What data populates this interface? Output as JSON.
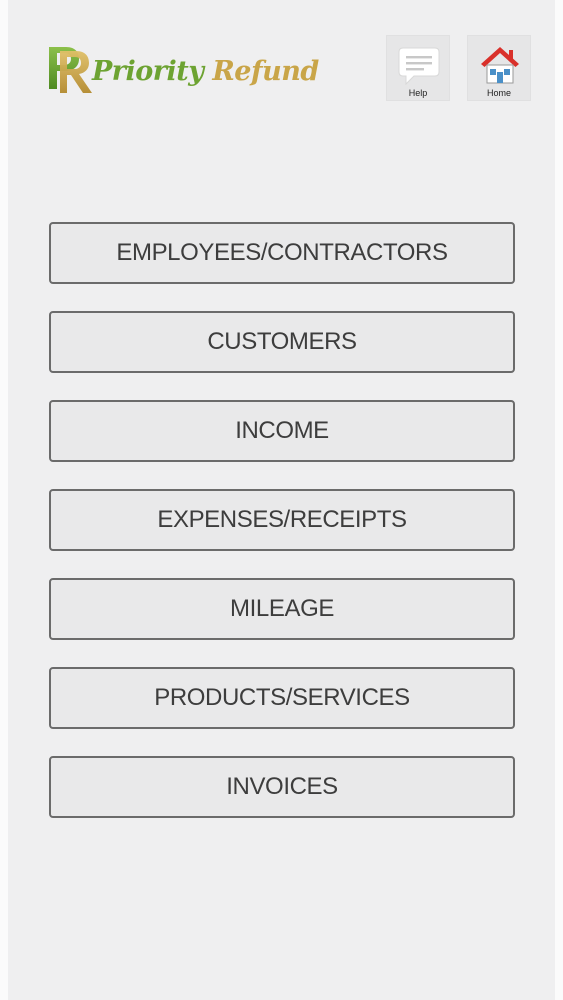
{
  "brand": {
    "logo_text_first": "Priority",
    "logo_text_second": "Refund",
    "color_green": "#6da332",
    "color_gold": "#c9a548"
  },
  "header": {
    "help": {
      "label": "Help",
      "icon": "speech-bubble-icon"
    },
    "home": {
      "label": "Home",
      "icon": "house-icon"
    }
  },
  "menu": {
    "items": [
      {
        "label": "EMPLOYEES/CONTRACTORS"
      },
      {
        "label": "CUSTOMERS"
      },
      {
        "label": "INCOME"
      },
      {
        "label": "EXPENSES/RECEIPTS"
      },
      {
        "label": "MILEAGE"
      },
      {
        "label": "PRODUCTS/SERVICES"
      },
      {
        "label": "INVOICES"
      }
    ]
  }
}
